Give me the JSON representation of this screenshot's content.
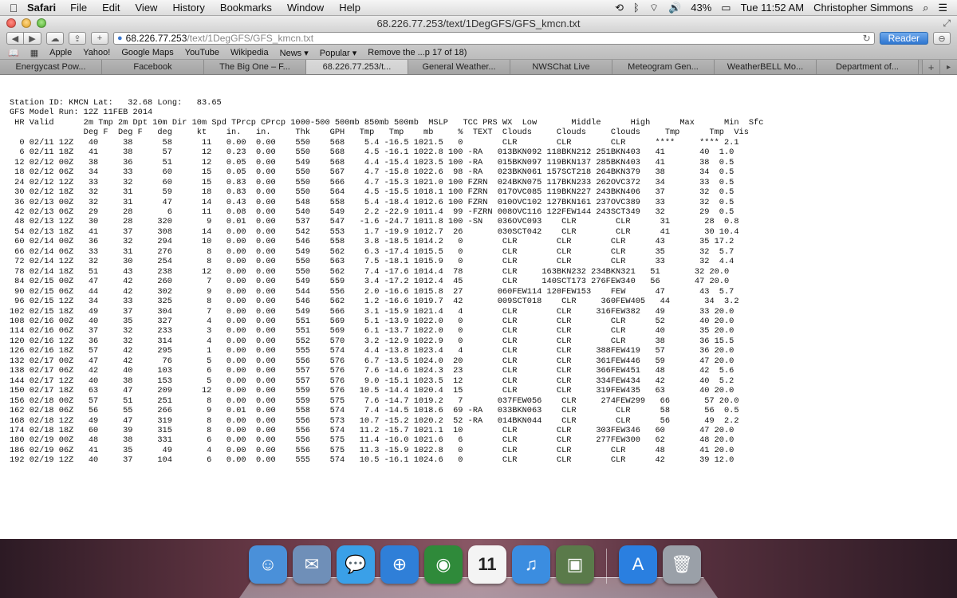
{
  "menubar": {
    "apple_icon": "apple-icon",
    "app_name": "Safari",
    "menus": [
      "File",
      "Edit",
      "View",
      "History",
      "Bookmarks",
      "Window",
      "Help"
    ],
    "battery": "43%",
    "clock": "Tue 11:52 AM",
    "user": "Christopher Simmons"
  },
  "window": {
    "title": "68.226.77.253/text/1DegGFS/GFS_kmcn.txt"
  },
  "toolbar": {
    "back": "◀",
    "forward": "▶",
    "cloud": "☁",
    "share": "⇪",
    "add": "+",
    "address_host": "68.226.77.253",
    "address_path": "/text/1DegGFS/GFS_kmcn.txt",
    "reload": "↻",
    "reader": "Reader",
    "download": "⊖"
  },
  "bookmarks": {
    "items": [
      "Apple",
      "Yahoo!",
      "Google Maps",
      "YouTube",
      "Wikipedia",
      "News ▾",
      "Popular ▾",
      "Remove the ...p 17 of 18)"
    ]
  },
  "tabs": {
    "items": [
      "Energycast Pow...",
      "Facebook",
      "The Big One – F...",
      "68.226.77.253/t...",
      "General Weather...",
      "NWSChat Live",
      "Meteogram Gen...",
      "WeatherBELL Mo...",
      "Department of..."
    ],
    "active_index": 3,
    "add": "+"
  },
  "content": {
    "station_line": "Station ID: KMCN Lat:   32.68 Long:   83.65",
    "model_run_line": "GFS Model Run: 12Z 11FEB 2014",
    "header1": " HR Valid      2m Tmp 2m Dpt 10m Dir 10m Spd TPrcp CPrcp 1000-500 500mb 850mb 500mb  MSLP   TCC PRS WX  Low       Middle      High      Max      Min  Sfc",
    "header2": "               Deg F  Deg F   deg     kt    in.   in.     Thk    GPH   Tmp   Tmp    mb     %  TEXT  Clouds     Clouds     Clouds     Tmp      Tmp  Vis",
    "rows": [
      "  0 02/11 12Z   40     38      58      11   0.00  0.00    550    568    5.4 -16.5 1021.5   0        CLR        CLR        CLR      ****     **** 2.1",
      "  6 02/11 18Z   41     38      57      12   0.23  0.00    550    568    4.5 -16.1 1022.8 100 -RA   013BKN092 118BKN212 251BKN403   41       40  1.0",
      " 12 02/12 00Z   38     36      51      12   0.05  0.00    549    568    4.4 -15.4 1023.5 100 -RA   015BKN097 119BKN137 285BKN403   41       38  0.5",
      " 18 02/12 06Z   34     33      60      15   0.05  0.00    550    567    4.7 -15.8 1022.6  98 -RA   023BKN061 157SCT218 264BKN379   38       34  0.5",
      " 24 02/12 12Z   33     32      60      15   0.83  0.00    550    566    4.7 -15.3 1021.0 100 FZRN  024BKN075 117BKN233 262OVC372   34       33  0.5",
      " 30 02/12 18Z   32     31      59      18   0.83  0.00    550    564    4.5 -15.5 1018.1 100 FZRN  017OVC085 119BKN227 243BKN406   37       32  0.5",
      " 36 02/13 00Z   32     31      47      14   0.43  0.00    548    558    5.4 -18.4 1012.6 100 FZRN  010OVC102 127BKN161 237OVC389   33       32  0.5",
      " 42 02/13 06Z   29     28       6      11   0.08  0.00    540    549    2.2 -22.9 1011.4  99 -FZRN 008OVC116 122FEW144 243SCT349   32       29  0.5",
      " 48 02/13 12Z   30     28     320       9   0.01  0.00    537    547   -1.6 -24.7 1011.8 100 -SN   036OVC093    CLR        CLR      31       28  0.8",
      " 54 02/13 18Z   41     37     308      14   0.00  0.00    542    553    1.7 -19.9 1012.7  26       030SCT042    CLR        CLR      41       30 10.4",
      " 60 02/14 00Z   36     32     294      10   0.00  0.00    546    558    3.8 -18.5 1014.2   0        CLR        CLR        CLR      43       35 17.2",
      " 66 02/14 06Z   33     31     276       8   0.00  0.00    549    562    6.3 -17.4 1015.5   0        CLR        CLR        CLR      35       32  5.7",
      " 72 02/14 12Z   32     30     254       8   0.00  0.00    550    563    7.5 -18.1 1015.9   0        CLR        CLR        CLR      33       32  4.4",
      " 78 02/14 18Z   51     43     238      12   0.00  0.00    550    562    7.4 -17.6 1014.4  78        CLR     163BKN232 234BKN321   51       32 20.0",
      " 84 02/15 00Z   47     42     260       7   0.00  0.00    549    559    3.4 -17.2 1012.4  45        CLR     140SCT173 276FEW340   56       47 20.0",
      " 90 02/15 06Z   44     42     302       9   0.00  0.00    544    556    2.0 -16.6 1015.8  27       060FEW114 120FEW153    FEW      47       43  5.7",
      " 96 02/15 12Z   34     33     325       8   0.00  0.00    546    562    1.2 -16.6 1019.7  42       009SCT018    CLR     360FEW405   44       34  3.2",
      "102 02/15 18Z   49     37     304       7   0.00  0.00    549    566    3.1 -15.9 1021.4   4        CLR        CLR     316FEW382   49       33 20.0",
      "108 02/16 00Z   40     35     327       4   0.00  0.00    551    569    5.1 -13.9 1022.0   0        CLR        CLR        CLR      52       40 20.0",
      "114 02/16 06Z   37     32     233       3   0.00  0.00    551    569    6.1 -13.7 1022.0   0        CLR        CLR        CLR      40       35 20.0",
      "120 02/16 12Z   36     32     314       4   0.00  0.00    552    570    3.2 -12.9 1022.9   0        CLR        CLR        CLR      38       36 15.5",
      "126 02/16 18Z   57     42     295       1   0.00  0.00    555    574    4.4 -13.8 1023.4   4        CLR        CLR     388FEW419   57       36 20.0",
      "132 02/17 00Z   47     42      76       5   0.00  0.00    556    576    6.7 -13.5 1024.0  20        CLR        CLR     361FEW446   59       47 20.0",
      "138 02/17 06Z   42     40     103       6   0.00  0.00    557    576    7.6 -14.6 1024.3  23        CLR        CLR     366FEW451   48       42  5.6",
      "144 02/17 12Z   40     38     153       5   0.00  0.00    557    576    9.0 -15.1 1023.5  12        CLR        CLR     334FEW434   42       40  5.2",
      "150 02/17 18Z   63     47     209      12   0.00  0.00    559    576   10.5 -14.4 1020.4  15        CLR        CLR     319FEW435   63       40 20.0",
      "156 02/18 00Z   57     51     251       8   0.00  0.00    559    575    7.6 -14.7 1019.2   7       037FEW056    CLR     274FEW299   66       57 20.0",
      "162 02/18 06Z   56     55     266       9   0.01  0.00    558    574    7.4 -14.5 1018.6  69 -RA   033BKN063    CLR        CLR      58       56  0.5",
      "168 02/18 12Z   49     47     319       8   0.00  0.00    556    573   10.7 -15.2 1020.2  52 -RA   014BKN044    CLR        CLR      56       49  2.2",
      "174 02/18 18Z   60     39     315       8   0.00  0.00    556    574   11.2 -15.7 1021.1  10        CLR        CLR     303FEW346   60       47 20.0",
      "180 02/19 00Z   48     38     331       6   0.00  0.00    556    575   11.4 -16.0 1021.6   6        CLR        CLR     277FEW300   62       48 20.0",
      "186 02/19 06Z   41     35      49       4   0.00  0.00    556    575   11.3 -15.9 1022.8   0        CLR        CLR        CLR      48       41 20.0",
      "192 02/19 12Z   40     37     104       6   0.00  0.00    555    574   10.5 -16.1 1024.6   0        CLR        CLR        CLR      42       39 12.0"
    ]
  },
  "dock": {
    "items": [
      {
        "name": "finder-icon",
        "glyph": "☺",
        "color": "#4a90d9"
      },
      {
        "name": "mail-icon",
        "glyph": "✉",
        "color": "#6f8fb8"
      },
      {
        "name": "messages-icon",
        "glyph": "💬",
        "color": "#3aa0e8"
      },
      {
        "name": "safari-icon",
        "glyph": "⊕",
        "color": "#2f7fd8"
      },
      {
        "name": "radar-app-icon",
        "glyph": "◉",
        "color": "#2f8a3a"
      },
      {
        "name": "calendar-icon",
        "glyph": "11",
        "color": "#f4f4f4"
      },
      {
        "name": "itunes-icon",
        "glyph": "♫",
        "color": "#3b8de0"
      },
      {
        "name": "photo-booth-icon",
        "glyph": "▣",
        "color": "#5a7a4a"
      },
      {
        "name": "app-store-icon",
        "glyph": "A",
        "color": "#2a7fe0"
      },
      {
        "name": "trash-icon",
        "glyph": "🗑",
        "color": "#9aa0a8"
      }
    ]
  }
}
